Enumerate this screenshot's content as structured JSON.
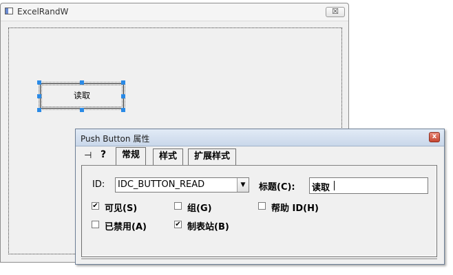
{
  "main_window": {
    "title": "ExcelRandW",
    "close_glyph": "☒",
    "design_button_label": "读取"
  },
  "prop_dialog": {
    "title": "Push Button 属性",
    "close_glyph": "x",
    "pin_glyph": "⊣",
    "help_glyph": "?",
    "tabs": [
      {
        "label": "常规",
        "active": true
      },
      {
        "label": "样式",
        "active": false
      },
      {
        "label": "扩展样式",
        "active": false
      }
    ],
    "id_label": "ID:",
    "id_value": "IDC_BUTTON_READ",
    "caption_label": "标题(C):",
    "caption_value": "读取",
    "checkboxes": [
      {
        "label": "可见(S)",
        "checked": true
      },
      {
        "label": "组(G)",
        "checked": false
      },
      {
        "label": "帮助 ID(H)",
        "checked": false
      },
      {
        "label": "已禁用(A)",
        "checked": false
      },
      {
        "label": "制表站(B)",
        "checked": true
      }
    ],
    "check_glyph": "✔"
  }
}
